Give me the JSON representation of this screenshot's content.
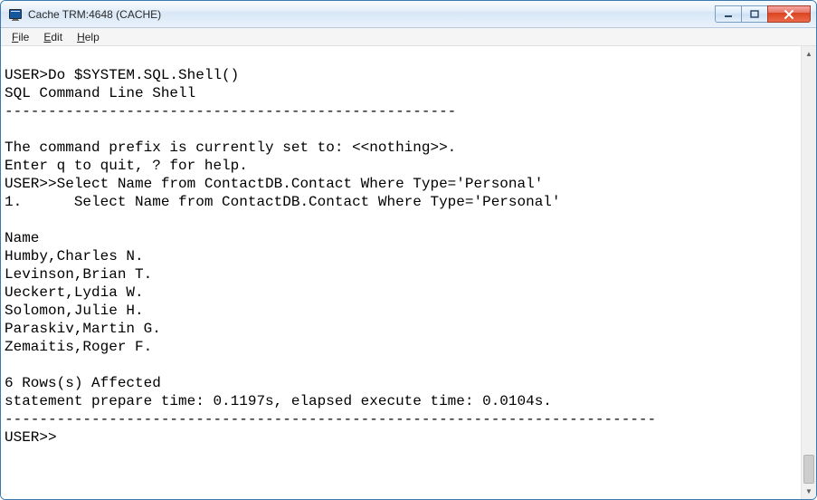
{
  "window": {
    "title": "Cache TRM:4648 (CACHE)"
  },
  "menu": {
    "file": "File",
    "edit": "Edit",
    "help": "Help"
  },
  "terminal": {
    "lines": [
      "",
      "USER>Do $SYSTEM.SQL.Shell()",
      "SQL Command Line Shell",
      "----------------------------------------------------",
      "",
      "The command prefix is currently set to: <<nothing>>.",
      "Enter q to quit, ? for help.",
      "USER>>Select Name from ContactDB.Contact Where Type='Personal'",
      "1.      Select Name from ContactDB.Contact Where Type='Personal'",
      "",
      "Name",
      "Humby,Charles N.",
      "Levinson,Brian T.",
      "Ueckert,Lydia W.",
      "Solomon,Julie H.",
      "Paraskiv,Martin G.",
      "Zemaitis,Roger F.",
      "",
      "6 Rows(s) Affected",
      "statement prepare time: 0.1197s, elapsed execute time: 0.0104s.",
      "---------------------------------------------------------------------------",
      "USER>>"
    ]
  }
}
